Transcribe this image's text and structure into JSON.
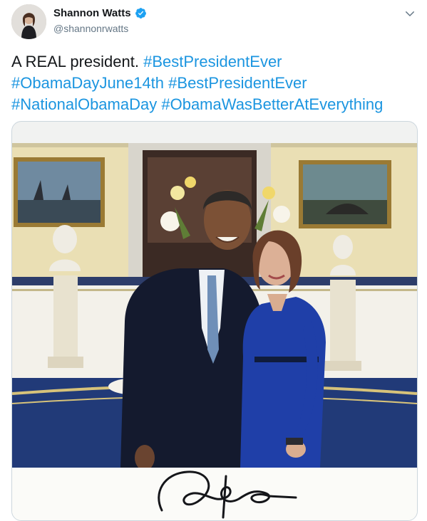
{
  "tweet": {
    "author": {
      "display_name": "Shannon Watts",
      "handle": "@shannonrwatts",
      "verified": true,
      "avatar_icon": "avatar-photo"
    },
    "menu_icon": "chevron-down-icon",
    "text_lines": [
      [
        {
          "text": "A REAL president. ",
          "type": "text"
        },
        {
          "text": "#BestPresidentEver",
          "type": "hashtag"
        }
      ],
      [
        {
          "text": "#ObamaDayJune14th",
          "type": "hashtag"
        },
        {
          "text": " ",
          "type": "text"
        },
        {
          "text": "#BestPresidentEver",
          "type": "hashtag"
        }
      ],
      [
        {
          "text": "#NationalObamaDay",
          "type": "hashtag"
        },
        {
          "text": " ",
          "type": "text"
        },
        {
          "text": "#ObamaWasBetterAtEverything",
          "type": "hashtag"
        }
      ]
    ],
    "media": {
      "kind": "photo",
      "scene": "two people posing in an oval room with paintings, busts and flowers; signature below"
    },
    "colors": {
      "link": "#1b95e0",
      "text": "#14171a",
      "secondary": "#657786",
      "verified": "#1da1f2"
    }
  }
}
